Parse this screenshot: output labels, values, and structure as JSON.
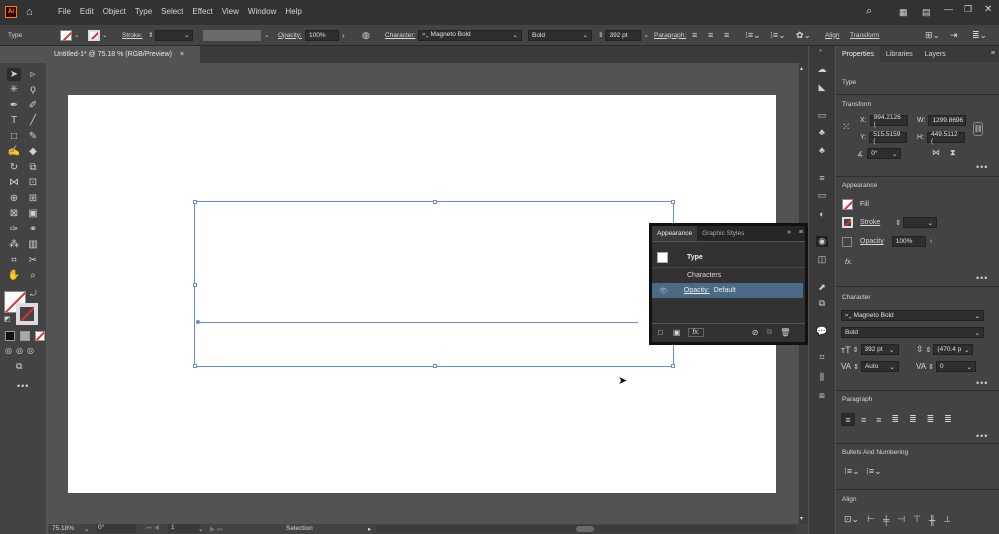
{
  "app": {
    "logo": "Ai"
  },
  "menu": [
    "File",
    "Edit",
    "Object",
    "Type",
    "Select",
    "Effect",
    "View",
    "Window",
    "Help"
  ],
  "control": {
    "type_label": "Type",
    "stroke_label": "Stroke:",
    "opacity_label": "Opacity:",
    "opacity_value": "100%",
    "character_label": "Character:",
    "font_name": "Magneto Bold",
    "font_style": "Bold",
    "font_size": "392 pt",
    "paragraph_label": "Paragraph:",
    "align_label": "Align",
    "transform_label": "Transform"
  },
  "document": {
    "tab_title": "Untitled-1* @ 75.18 % (RGB/Preview)",
    "close": "×"
  },
  "status": {
    "zoom": "75.18%",
    "rotation": "0°",
    "artboard": "1",
    "tool": "Selection"
  },
  "panel_tabs": [
    "Properties",
    "Libraries",
    "Layers"
  ],
  "properties": {
    "type_label": "Type",
    "transform": {
      "title": "Transform",
      "x_label": "X:",
      "x": "994.2126 (",
      "y_label": "Y:",
      "y": "515.5159 (",
      "w_label": "W:",
      "w": "1299.8696",
      "h_label": "H:",
      "h": "449.5112 (",
      "angle": "0°"
    },
    "appearance": {
      "title": "Appearance",
      "fill_label": "Fill",
      "stroke_label": "Stroke",
      "opacity_label": "Opacity",
      "opacity_value": "100%",
      "fx_label": "fx."
    },
    "character": {
      "title": "Character",
      "font": "Magneto Bold",
      "style": "Bold",
      "size": "392 pt",
      "leading": "(470.4 p",
      "kerning": "Auto",
      "tracking": "0"
    },
    "paragraph": {
      "title": "Paragraph"
    },
    "bullets": {
      "title": "Bullets And Numbering"
    },
    "align": {
      "title": "Align"
    }
  },
  "appearance_panel": {
    "tabs": [
      "Appearance",
      "Graphic Styles"
    ],
    "type_row": "Type",
    "characters_row": "Characters",
    "opacity_row_label": "Opacity:",
    "opacity_row_value": "Default",
    "fx_label": "fx."
  },
  "colors": {
    "selection": "#6a8bd6",
    "accent_none": "#e03030",
    "highlight_row": "#4b6a86"
  }
}
